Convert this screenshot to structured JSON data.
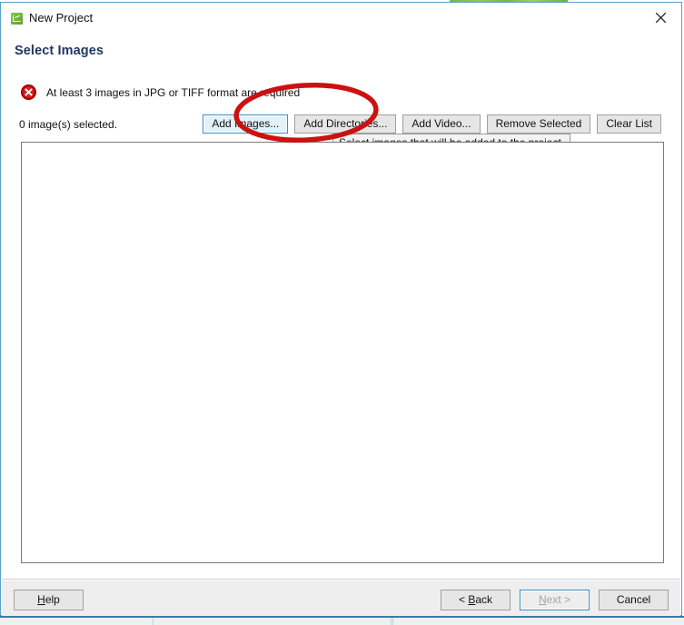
{
  "window": {
    "title": "New Project",
    "icon": "app-green-chart-icon",
    "close_label": "×"
  },
  "page": {
    "heading": "Select Images",
    "validation": {
      "icon": "error-circle-icon",
      "message": "At least 3 images in JPG or TIFF format are required"
    },
    "selected_count_label": "0 image(s) selected."
  },
  "toolbar": {
    "add_images_label": "Add Images...",
    "add_directories_label": "Add Directories...",
    "add_video_label": "Add Video...",
    "remove_selected_label": "Remove Selected",
    "clear_list_label": "Clear List"
  },
  "tooltip": {
    "text": "Select images that will be added to the project."
  },
  "image_list": {
    "items": [],
    "empty_text": ""
  },
  "footer": {
    "help_label": "Help",
    "help_mnemonic": "H",
    "back_label": "< Back",
    "back_mnemonic": "B",
    "next_label": "Next >",
    "next_mnemonic": "N",
    "next_enabled": false,
    "cancel_label": "Cancel"
  },
  "annotation": {
    "shape": "ellipse",
    "color": "#cc1111",
    "target": "add-images-button"
  },
  "colors": {
    "dialog_border": "#5aa0c8",
    "heading": "#1f3864",
    "error": "#c00000",
    "focus_ring": "#3b8ec2",
    "button_face": "#e6e6e6",
    "footer_bg": "#eeeeee",
    "annotation_red": "#cc1111",
    "brand_green": "#8dc63f"
  }
}
